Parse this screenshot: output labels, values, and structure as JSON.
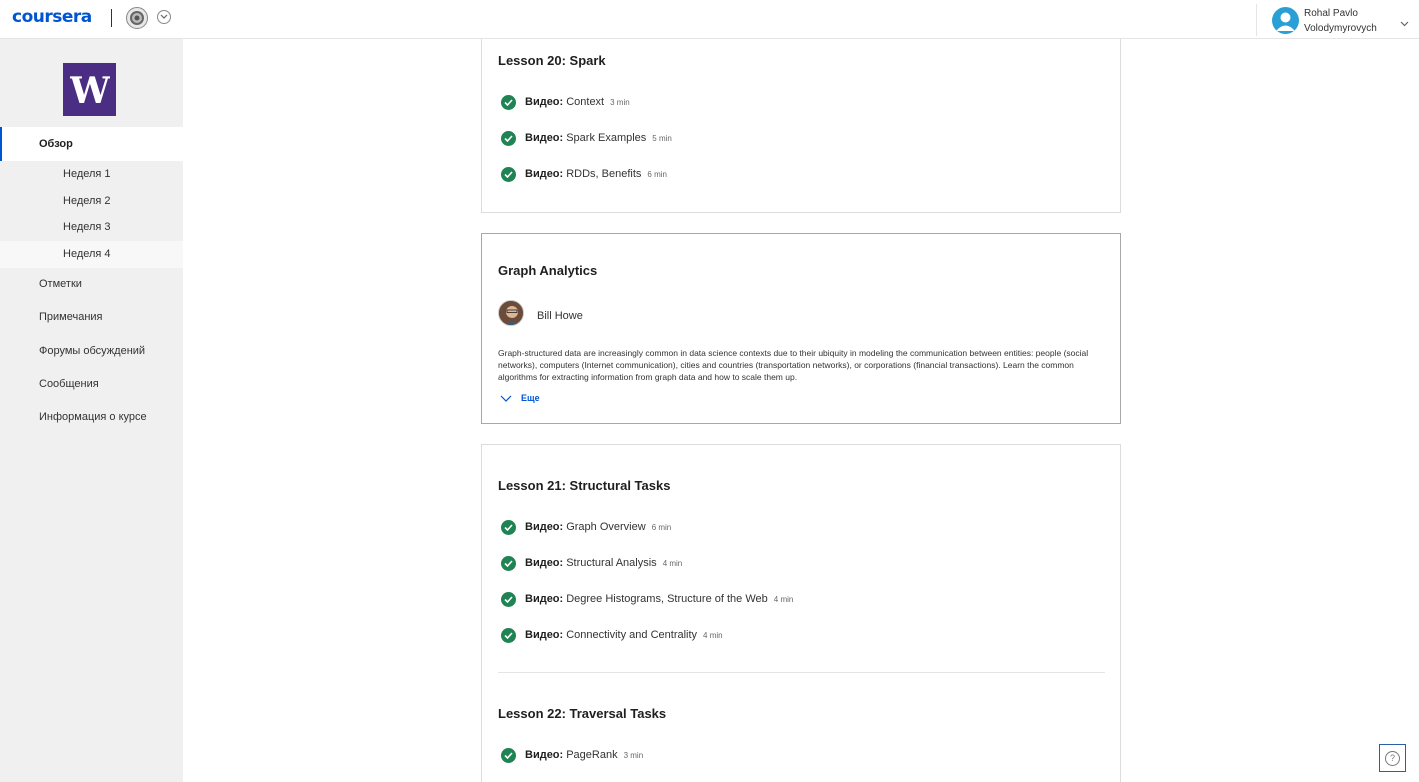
{
  "header": {
    "logo_text": "coursera",
    "user_name_line1": "Rohal Pavlo",
    "user_name_line2": "Volodymyrovych"
  },
  "sidebar": {
    "univ_logo_letter": "W",
    "overview": "Обзор",
    "weeks": [
      "Неделя 1",
      "Неделя 2",
      "Неделя 3",
      "Неделя 4"
    ],
    "items": [
      "Отметки",
      "Примечания",
      "Форумы обсуждений",
      "Сообщения",
      "Информация о курсе"
    ]
  },
  "lesson20": {
    "title": "Lesson 20: Spark",
    "items": [
      {
        "type": "Видео:",
        "name": "Context",
        "duration": "3 min"
      },
      {
        "type": "Видео:",
        "name": "Spark Examples",
        "duration": "5 min"
      },
      {
        "type": "Видео:",
        "name": "RDDs, Benefits",
        "duration": "6 min"
      }
    ]
  },
  "module": {
    "title": "Graph Analytics",
    "instructor": "Bill Howe",
    "description": "Graph-structured data are increasingly common in data science contexts due to their ubiquity in modeling the communication between entities: people (social networks), computers (Internet communication), cities and countries (transportation networks), or corporations (financial transactions). Learn the common algorithms for extracting information from graph data and how to scale them up.",
    "more_label": "Еще"
  },
  "lesson21": {
    "title": "Lesson 21: Structural Tasks",
    "items": [
      {
        "type": "Видео:",
        "name": "Graph Overview",
        "duration": "6 min"
      },
      {
        "type": "Видео:",
        "name": "Structural Analysis",
        "duration": "4 min"
      },
      {
        "type": "Видео:",
        "name": "Degree Histograms, Structure of the Web",
        "duration": "4 min"
      },
      {
        "type": "Видео:",
        "name": "Connectivity and Centrality",
        "duration": "4 min"
      }
    ]
  },
  "lesson22": {
    "title": "Lesson 22: Traversal Tasks",
    "items": [
      {
        "type": "Видео:",
        "name": "PageRank",
        "duration": "3 min"
      }
    ]
  },
  "help_label": "?"
}
